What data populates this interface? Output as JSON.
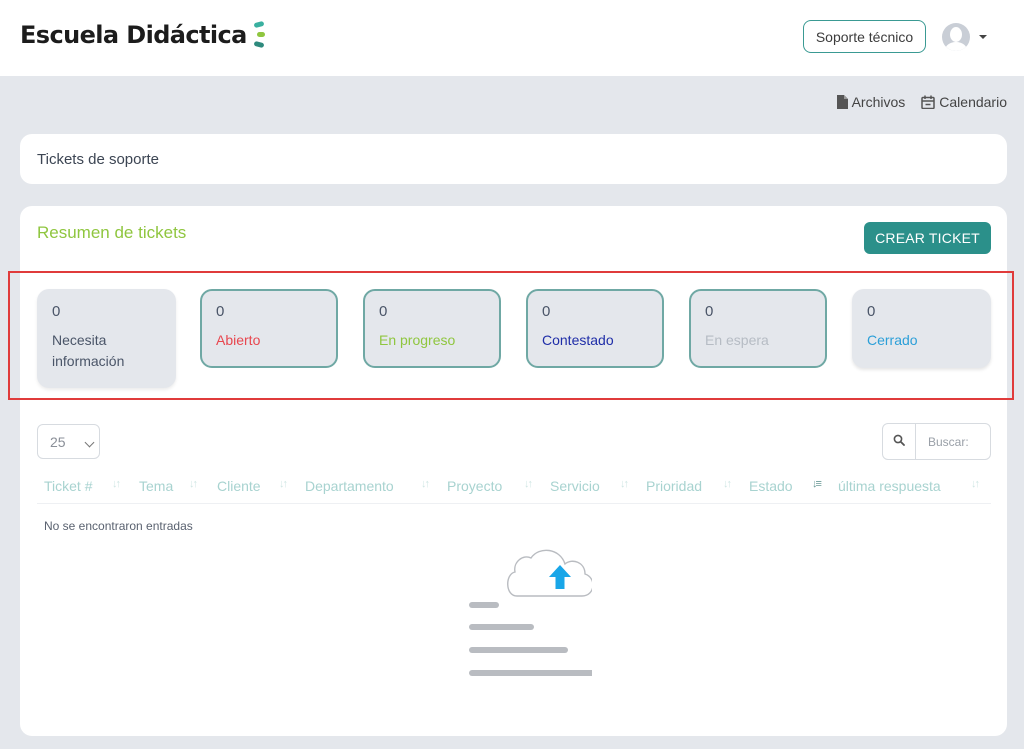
{
  "header": {
    "logo_text": "Escuela Didáctica",
    "support_button": "Soporte técnico",
    "avatar_icon": "user-avatar-icon"
  },
  "top_links": {
    "files": "Archivos",
    "calendar": "Calendario"
  },
  "page_title": "Tickets de soporte",
  "summary": {
    "title": "Resumen de tickets",
    "create_button": "CREAR TICKET",
    "stats": [
      {
        "count": "0",
        "label": "Necesita información",
        "color": "#4a5568"
      },
      {
        "count": "0",
        "label": "Abierto",
        "color": "#e8474f"
      },
      {
        "count": "0",
        "label": "En progreso",
        "color": "#8fc63f"
      },
      {
        "count": "0",
        "label": "Contestado",
        "color": "#1f2ea8"
      },
      {
        "count": "0",
        "label": "En espera",
        "color": "#b6bcc4"
      },
      {
        "count": "0",
        "label": "Cerrado",
        "color": "#2b9fd8"
      }
    ]
  },
  "table": {
    "page_size": "25",
    "search_placeholder": "Buscar:",
    "columns": [
      "Ticket #",
      "Tema",
      "Cliente",
      "Departamento",
      "Proyecto",
      "Servicio",
      "Prioridad",
      "Estado",
      "última respuesta"
    ],
    "empty_message": "No se encontraron entradas"
  },
  "colors": {
    "accent": "#2b908a",
    "summary_title": "#8fc63f",
    "highlight": "#e03b3b"
  }
}
